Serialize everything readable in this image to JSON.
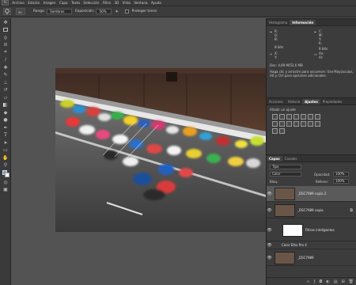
{
  "menubar": {
    "logo": "Ps",
    "items": [
      "Archivo",
      "Edición",
      "Imagen",
      "Capa",
      "Texto",
      "Selección",
      "Filtro",
      "3D",
      "Vista",
      "Ventana",
      "Ayuda"
    ]
  },
  "options": {
    "tool_size": "30",
    "rango_label": "Rango:",
    "rango_value": "Sombras",
    "exposicion_label": "Exposición:",
    "exposicion_value": "50%",
    "protect_label": "Proteger tonos"
  },
  "tools": [
    "move",
    "marquee",
    "lasso",
    "quick-select",
    "crop",
    "eyedropper",
    "heal",
    "brush",
    "clone",
    "history",
    "eraser",
    "gradient",
    "blur",
    "dodge",
    "pen",
    "type",
    "path-select",
    "rectangle",
    "hand",
    "zoom",
    "colors",
    "quickmask",
    "screenmode"
  ],
  "panel_info": {
    "tabs": [
      "Histograma",
      "Información"
    ],
    "r_label": "R:",
    "g_label": "G:",
    "b_label": "B:",
    "c_label": "C:",
    "m_label": "M:",
    "y_label": "Y:",
    "k_label": "K:",
    "bits1": "8 bits",
    "bits2": "8 bits",
    "x_label": "X:",
    "y2_label": "Y:",
    "w_label": "An:",
    "h_label": "Al:",
    "doc": "Doc: 4,89 M/52,6 MB",
    "hint": "Haga clic y arrastre para oscurecer. Use Mayúsculas, Alt y Ctrl para opciones adicionales."
  },
  "panel_adj": {
    "tabs": [
      "Acciones",
      "Historia",
      "Ajustes",
      "Propiedades"
    ],
    "title": "Añadir un ajuste"
  },
  "panel_layers": {
    "tabs": [
      "Capas",
      "Canales"
    ],
    "filter_label": "Tipo",
    "blend": "Color",
    "opacity_label": "Opacidad:",
    "opacity_value": "100%",
    "lock_label": "Bloq.:",
    "fill_label": "Relleno:",
    "fill_value": "100%",
    "layers": [
      {
        "name": "_DSC7989 copia 2",
        "selected": true
      },
      {
        "name": "_DSC7989 copia",
        "selected": false
      },
      {
        "name": "Filtros inteligentes",
        "selected": false
      },
      {
        "name": "Color Efex Pro 4",
        "selected": false
      },
      {
        "name": "_DSC7989",
        "selected": false
      }
    ]
  }
}
